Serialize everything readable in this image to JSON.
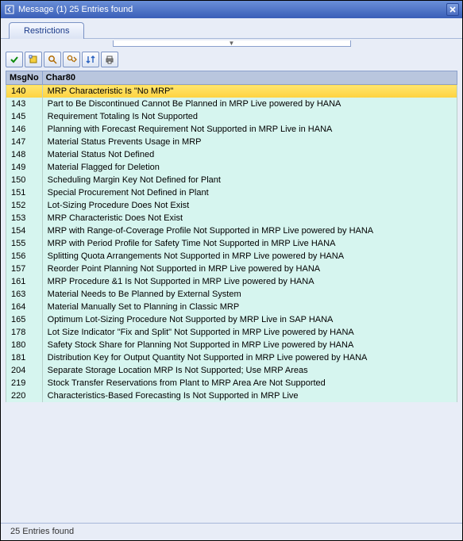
{
  "titlebar": {
    "title": "Message (1)   25 Entries found"
  },
  "tab": {
    "label": "Restrictions"
  },
  "collapse_handle": "▼",
  "table": {
    "columns": {
      "msgno": "MsgNo",
      "char80": "Char80"
    },
    "rows": [
      {
        "msgno": "140",
        "text": "MRP Characteristic Is \"No MRP\"",
        "selected": true
      },
      {
        "msgno": "143",
        "text": "Part to Be Discontinued Cannot Be Planned in MRP Live powered by HANA"
      },
      {
        "msgno": "145",
        "text": "Requirement Totaling Is Not Supported"
      },
      {
        "msgno": "146",
        "text": "Planning with Forecast Requirement Not Supported in MRP Live in HANA"
      },
      {
        "msgno": "147",
        "text": "Material Status Prevents Usage in MRP"
      },
      {
        "msgno": "148",
        "text": "Material Status Not Defined"
      },
      {
        "msgno": "149",
        "text": "Material Flagged for Deletion"
      },
      {
        "msgno": "150",
        "text": "Scheduling Margin Key Not Defined for Plant"
      },
      {
        "msgno": "151",
        "text": "Special Procurement Not Defined in Plant"
      },
      {
        "msgno": "152",
        "text": "Lot-Sizing Procedure Does Not Exist"
      },
      {
        "msgno": "153",
        "text": "MRP Characteristic Does Not Exist"
      },
      {
        "msgno": "154",
        "text": "MRP with Range-of-Coverage Profile Not Supported in MRP Live powered by HANA"
      },
      {
        "msgno": "155",
        "text": "MRP with Period Profile for Safety Time Not Supported in MRP Live HANA"
      },
      {
        "msgno": "156",
        "text": "Splitting Quota Arrangements Not Supported in MRP Live powered by HANA"
      },
      {
        "msgno": "157",
        "text": "Reorder Point Planning Not Supported in MRP Live powered by HANA"
      },
      {
        "msgno": "161",
        "text": "MRP Procedure &1 Is Not Supported in MRP Live powered by HANA"
      },
      {
        "msgno": "163",
        "text": "Material Needs to Be Planned by External System"
      },
      {
        "msgno": "164",
        "text": "Material Manually Set to Planning in Classic MRP"
      },
      {
        "msgno": "165",
        "text": "Optimum Lot-Sizing Procedure Not Supported by MRP Live in SAP HANA"
      },
      {
        "msgno": "178",
        "text": "Lot Size Indicator \"Fix and Split\" Not Supported in MRP Live powered by HANA"
      },
      {
        "msgno": "180",
        "text": "Safety Stock Share for Planning Not Supported in MRP Live powered by HANA"
      },
      {
        "msgno": "181",
        "text": "Distribution Key for Output Quantity Not Supported in MRP Live powered by HANA"
      },
      {
        "msgno": "204",
        "text": "Separate Storage Location MRP Is Not Supported; Use MRP Areas"
      },
      {
        "msgno": "219",
        "text": "Stock Transfer Reservations from Plant to MRP Area Are Not Supported"
      },
      {
        "msgno": "220",
        "text": "Characteristics-Based Forecasting Is Not Supported in MRP Live"
      }
    ]
  },
  "statusbar": {
    "text": "25 Entries found"
  }
}
